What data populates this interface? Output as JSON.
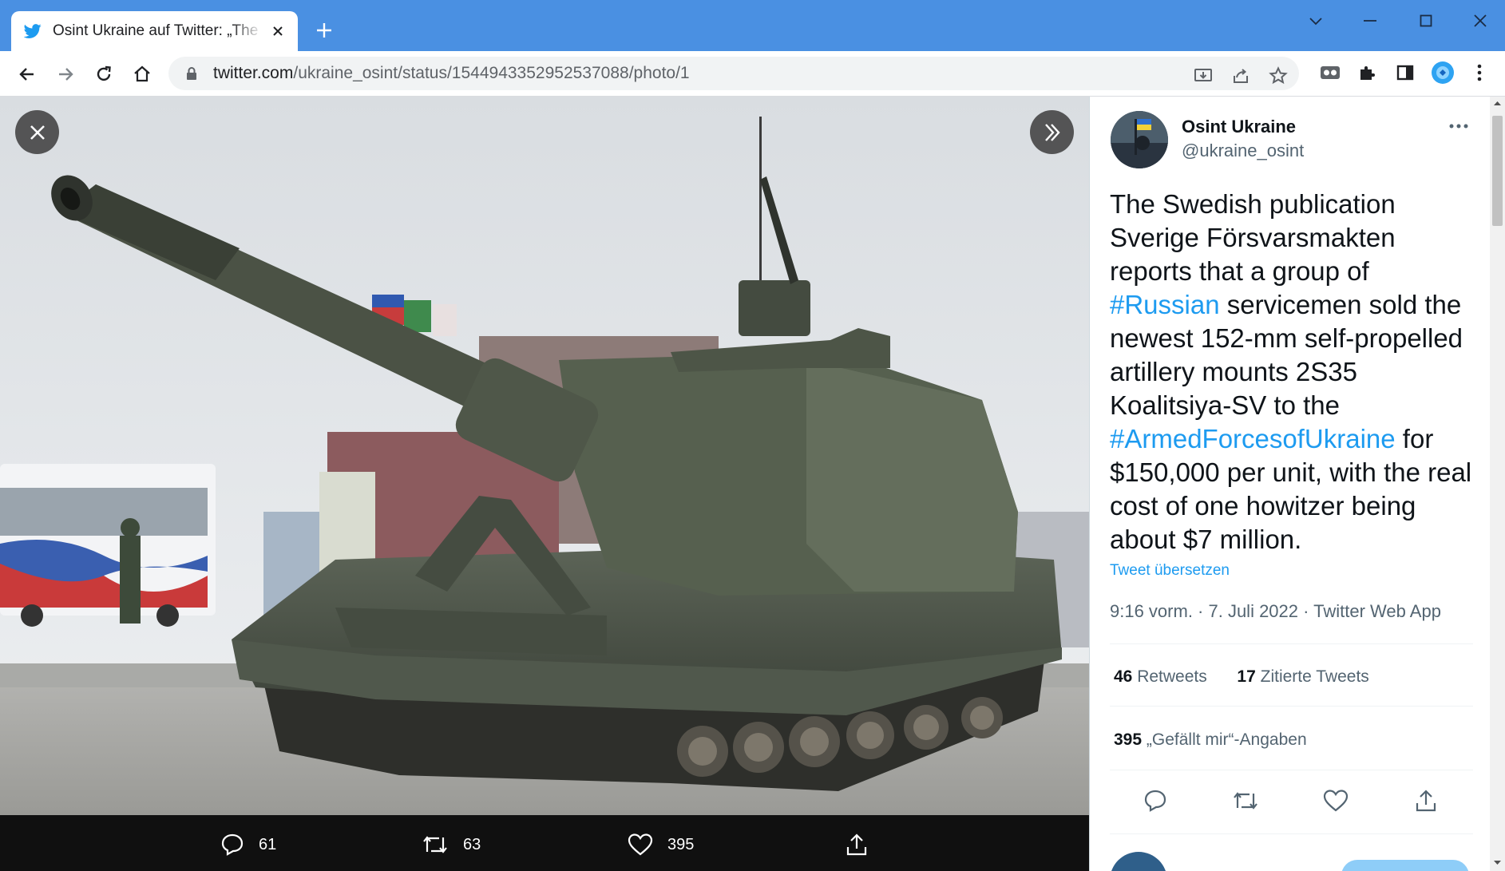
{
  "browser": {
    "tab_title": "Osint Ukraine auf Twitter: „The Swedish publication",
    "url_host": "twitter.com",
    "url_path": "/ukraine_osint/status/1544943352952537088/photo/1"
  },
  "photo_actions": {
    "replies": "61",
    "retweets": "63",
    "likes": "395"
  },
  "tweet": {
    "author_name": "Osint Ukraine",
    "author_handle": "@ukraine_osint",
    "text_1": "The Swedish publication Sverige Försvarsmakten reports that a group of ",
    "hashtag_1": "#Russian",
    "text_2": "  servicemen sold the newest 152-mm self-propelled artillery mounts 2S35 Koalitsiya-SV to the ",
    "hashtag_2": "#ArmedForcesofUkraine",
    "text_3": " for $150,000 per unit, with the real cost of one howitzer being about $7 million.",
    "translate_label": "Tweet übersetzen",
    "meta": "9:16 vorm. · 7. Juli 2022 · Twitter Web App",
    "retweets_count": "46",
    "retweets_label": " Retweets",
    "quotes_count": "17",
    "quotes_label": " Zitierte Tweets",
    "likes_count": "395",
    "likes_label": " „Gefällt mir“-Angaben"
  },
  "colors": {
    "browser_frame": "#4a90e2",
    "twitter_blue": "#1d9bf0",
    "text_primary": "#0f1419",
    "text_secondary": "#536471"
  }
}
